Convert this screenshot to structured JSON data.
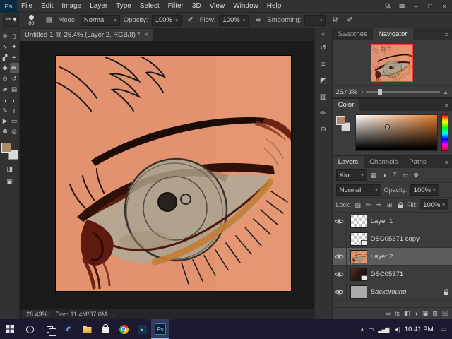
{
  "icons": {
    "workspace": "▦",
    "minimize": "–",
    "maximize": "□",
    "close": "×",
    "tab_close": "×",
    "chevron_down": "▾",
    "brush_tool": "✏",
    "panel_toggle": "▤",
    "pressure": "✐",
    "airbrush": "≋",
    "gear": "⚙",
    "status_arrow": "›",
    "dock_expand": "«",
    "quick_mask": "◨",
    "screen_mode": "▣",
    "zoom_out": "▴",
    "zoom_in": "▲",
    "notification": "▭",
    "panel_menu": "≡"
  },
  "menubar": {
    "items": [
      "File",
      "Edit",
      "Image",
      "Layer",
      "Type",
      "Select",
      "Filter",
      "3D",
      "View",
      "Window",
      "Help"
    ]
  },
  "options": {
    "brush_size": "80",
    "mode_label": "Mode:",
    "mode_value": "Normal",
    "opacity_label": "Opacity:",
    "opacity_value": "100%",
    "flow_label": "Flow:",
    "flow_value": "100%",
    "smoothing_label": "Smoothing:",
    "smoothing_value": ""
  },
  "document": {
    "tab_title": "Untitled-1 @ 26.4% (Layer 2, RGB/8) *"
  },
  "toolbar": {
    "foreground_color": "#ad8a67",
    "background_color": "#d8d8d8",
    "tools": [
      {
        "id": "move",
        "glyph": "✛"
      },
      {
        "id": "marquee",
        "glyph": "▯"
      },
      {
        "id": "lasso",
        "glyph": "∿"
      },
      {
        "id": "quick-selection",
        "glyph": "✦"
      },
      {
        "id": "crop",
        "glyph": "▞"
      },
      {
        "id": "eyedropper",
        "glyph": "✒"
      },
      {
        "id": "healing-brush",
        "glyph": "✚"
      },
      {
        "id": "brush",
        "glyph": "✏",
        "active": true
      },
      {
        "id": "clone-stamp",
        "glyph": "⊙"
      },
      {
        "id": "history-brush",
        "glyph": "↺"
      },
      {
        "id": "eraser",
        "glyph": "▰"
      },
      {
        "id": "gradient",
        "glyph": "▤"
      },
      {
        "id": "blur",
        "glyph": "◑"
      },
      {
        "id": "dodge",
        "glyph": "◐"
      },
      {
        "id": "pen",
        "glyph": "✎"
      },
      {
        "id": "type",
        "glyph": "T"
      },
      {
        "id": "path-selection",
        "glyph": "▶"
      },
      {
        "id": "shape",
        "glyph": "▭"
      },
      {
        "id": "hand",
        "glyph": "✽"
      },
      {
        "id": "zoom",
        "glyph": "◎"
      }
    ]
  },
  "dock": {
    "icons": [
      {
        "id": "history",
        "glyph": "↺"
      },
      {
        "id": "properties",
        "glyph": "≡"
      },
      {
        "id": "adjustments",
        "glyph": "◩"
      },
      {
        "id": "libraries",
        "glyph": "▥"
      },
      {
        "id": "brush-settings",
        "glyph": "✏"
      },
      {
        "id": "clone-source",
        "glyph": "⊕"
      }
    ]
  },
  "status": {
    "zoom": "26.43%",
    "doc": "Doc: 11.4M/37.0M"
  },
  "navigator": {
    "tabs": [
      "Swatches",
      "Navigator"
    ],
    "active_tab": "Navigator",
    "zoom": "26.43%"
  },
  "color": {
    "title": "Color",
    "field_hue": "#e07b2a"
  },
  "layers_panel": {
    "tabs": [
      "Layers",
      "Channels",
      "Paths"
    ],
    "active_tab": "Layers",
    "filter_label": "Kind",
    "blend_mode": "Normal",
    "opacity_label": "Opacity:",
    "opacity_value": "100%",
    "lock_label": "Lock:",
    "fill_label": "Fill:",
    "fill_value": "100%",
    "filter_icons": [
      {
        "id": "filter-pixel",
        "glyph": "▦"
      },
      {
        "id": "filter-adjustment",
        "glyph": "◑"
      },
      {
        "id": "filter-type",
        "glyph": "T"
      },
      {
        "id": "filter-shape",
        "glyph": "▭"
      },
      {
        "id": "filter-smart-object",
        "glyph": "❖"
      }
    ],
    "lock_icons": [
      {
        "id": "lock-transparency",
        "glyph": "▨"
      },
      {
        "id": "lock-pixels",
        "glyph": "✏"
      },
      {
        "id": "lock-position",
        "glyph": "✛"
      },
      {
        "id": "lock-artboard",
        "glyph": "⊞"
      },
      {
        "id": "lock-all",
        "glyph": "lock-svg"
      }
    ],
    "items": [
      {
        "name": "Layer 1",
        "visible": true,
        "thumb": "checker"
      },
      {
        "name": "DSC05371 copy",
        "visible": false,
        "thumb": "checker",
        "badge": true
      },
      {
        "name": "Layer 2",
        "visible": true,
        "thumb": "art",
        "selected": true
      },
      {
        "name": "DSC05371",
        "visible": true,
        "thumb": "photo",
        "badge": true
      },
      {
        "name": "Background",
        "visible": true,
        "thumb": "gray",
        "locked": true,
        "italic": true
      }
    ],
    "footer_icons": [
      {
        "id": "link-layers",
        "glyph": "∞"
      },
      {
        "id": "layer-effects",
        "glyph": "fx"
      },
      {
        "id": "layer-mask",
        "glyph": "◧"
      },
      {
        "id": "adjustment-layer",
        "glyph": "◑"
      },
      {
        "id": "new-group",
        "glyph": "▣"
      },
      {
        "id": "new-layer",
        "glyph": "⊞"
      },
      {
        "id": "delete-layer",
        "glyph": "☒"
      }
    ]
  },
  "taskbar": {
    "time": "10:41 PM",
    "apps": [
      {
        "id": "edge",
        "type": "edge",
        "label": "e"
      },
      {
        "id": "file-explorer",
        "type": "folder"
      },
      {
        "id": "store",
        "type": "store"
      },
      {
        "id": "chrome",
        "type": "chrome"
      },
      {
        "id": "media-app",
        "type": "media",
        "label": "▸"
      },
      {
        "id": "photoshop",
        "type": "ps",
        "label": "Ps",
        "active": true
      }
    ],
    "tray": [
      {
        "id": "tray-chevron",
        "glyph": "∧"
      },
      {
        "id": "tray-display",
        "glyph": "▭"
      },
      {
        "id": "tray-network",
        "glyph": "▂▄▆"
      },
      {
        "id": "tray-volume",
        "glyph": "◄)"
      }
    ]
  }
}
